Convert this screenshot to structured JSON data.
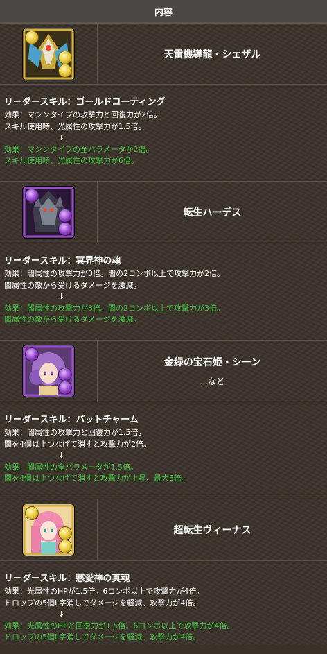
{
  "header": {
    "title": "内容"
  },
  "entries": [
    {
      "name": "天雷機導龍・シェザル",
      "attribute_color": "#e4c230",
      "skill_title": "リーダースキル：ゴールドコーティング",
      "before": [
        "効果：マシンタイプの攻撃力と回復力が2倍。",
        "スキル使用時、光属性の攻撃力が1.5倍。"
      ],
      "arrow": "↓",
      "after": [
        "効果：マシンタイプの全パラメータが2倍。",
        "スキル使用時、光属性の攻撃力が6倍。"
      ]
    },
    {
      "name": "転生ハーデス",
      "attribute_color": "#8e3fc8",
      "skill_title": "リーダースキル：冥界神の魂",
      "before": [
        "効果：闇属性の攻撃力が3倍。闇の2コンボ以上で攻撃力が2倍。",
        "闇属性の敵から受けるダメージを激減。"
      ],
      "arrow": "↓",
      "after": [
        "効果：闇属性の攻撃力が3倍。闇の2コンボ以上で攻撃力が3倍。",
        "闇属性の敵から受けるダメージを激減。"
      ]
    },
    {
      "name": "金緑の宝石姫・シーン",
      "name_extra": "…など",
      "attribute_color": "#8e3fc8",
      "skill_title": "リーダースキル：バットチャーム",
      "before": [
        "効果：闇属性の攻撃力と回復力が1.5倍。",
        "闇を4個以上つなげて消すと攻撃力が2倍。"
      ],
      "arrow": "↓",
      "after": [
        "効果：闇属性の全パラメータが1.5倍。",
        "闇を4個以上つなげて消すと攻撃力が上昇、最大8倍。"
      ]
    },
    {
      "name": "超転生ヴィーナス",
      "attribute_color": "#e4c230",
      "skill_title": "リーダースキル：慈愛神の真魂",
      "before": [
        "効果：光属性のHPが1.5倍。6コンボ以上で攻撃力が4倍。",
        "ドロップの5個L字消しでダメージを軽減、攻撃力が4倍。"
      ],
      "arrow": "↓",
      "after": [
        "効果：光属性のHPと回復力が1.5倍。6コンボ以上で攻撃力が4倍。",
        "ドロップの5個L字消しでダメージを軽減、攻撃力が4倍。"
      ]
    }
  ]
}
